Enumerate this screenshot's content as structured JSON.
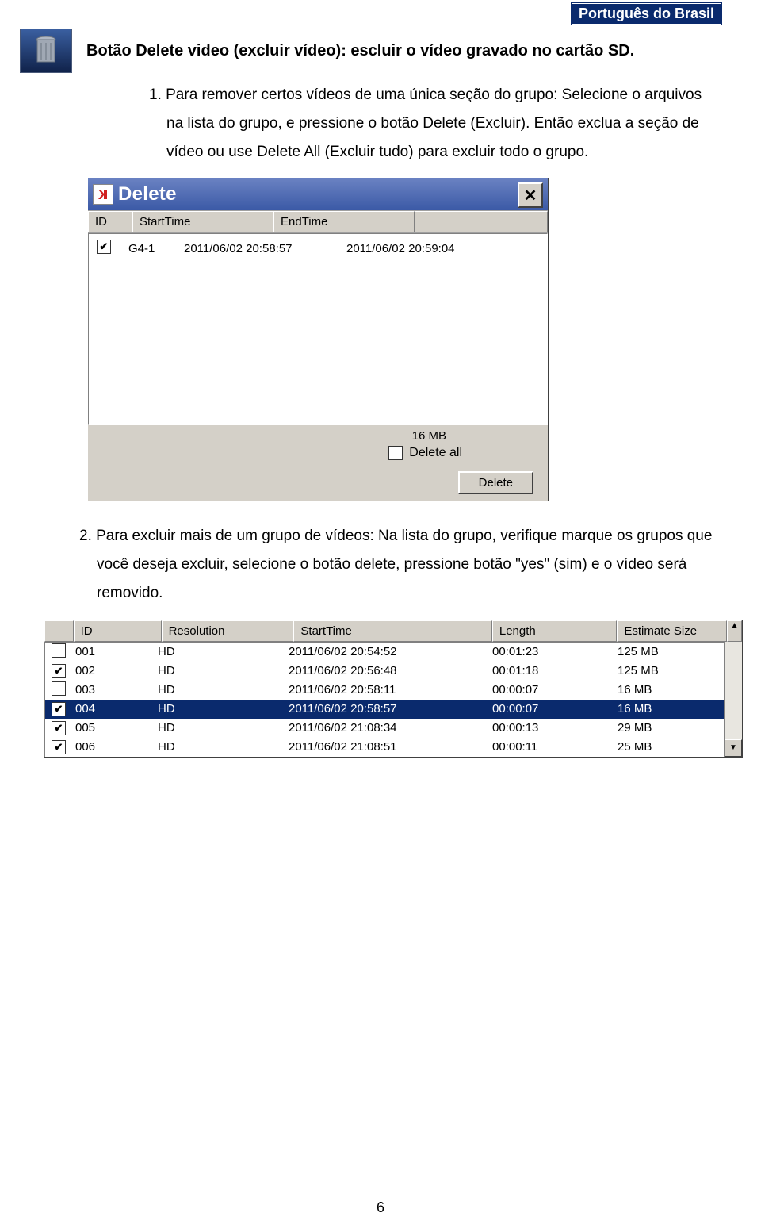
{
  "lang_badge": "Português do Brasil",
  "heading": "Botão Delete video (excluir vídeo): escluir o vídeo gravado no cartão SD.",
  "para1": "1. Para remover certos vídeos de uma única seção do grupo: Selecione o arquivos na lista do grupo, e pressione o botão Delete (Excluir). Então exclua a seção de vídeo ou use Delete All (Excluir tudo) para excluir todo o grupo.",
  "dialog": {
    "title": "Delete",
    "close": "✕",
    "headers": {
      "id": "ID",
      "start": "StartTime",
      "end": "EndTime"
    },
    "rows": [
      {
        "checked": true,
        "id": "G4-1",
        "start": "2011/06/02 20:58:57",
        "end": "2011/06/02 20:59:04"
      }
    ],
    "size": "16 MB",
    "delete_all_label": "Delete all",
    "delete_btn": "Delete"
  },
  "para2": "2. Para excluir mais de um grupo de vídeos: Na lista do grupo, verifique marque os grupos que você deseja excluir, selecione o botão delete, pressione botão \"yes\" (sim) e o vídeo será removido.",
  "wide": {
    "headers": {
      "id": "ID",
      "res": "Resolution",
      "st": "StartTime",
      "len": "Length",
      "es": "Estimate Size"
    },
    "rows": [
      {
        "checked": false,
        "id": "001",
        "res": "HD",
        "st": "2011/06/02 20:54:52",
        "len": "00:01:23",
        "es": "125 MB",
        "selected": false
      },
      {
        "checked": true,
        "id": "002",
        "res": "HD",
        "st": "2011/06/02 20:56:48",
        "len": "00:01:18",
        "es": "125 MB",
        "selected": false
      },
      {
        "checked": false,
        "id": "003",
        "res": "HD",
        "st": "2011/06/02 20:58:11",
        "len": "00:00:07",
        "es": "16 MB",
        "selected": false
      },
      {
        "checked": true,
        "id": "004",
        "res": "HD",
        "st": "2011/06/02 20:58:57",
        "len": "00:00:07",
        "es": "16 MB",
        "selected": true
      },
      {
        "checked": true,
        "id": "005",
        "res": "HD",
        "st": "2011/06/02 21:08:34",
        "len": "00:00:13",
        "es": "29 MB",
        "selected": false
      },
      {
        "checked": true,
        "id": "006",
        "res": "HD",
        "st": "2011/06/02 21:08:51",
        "len": "00:00:11",
        "es": "25 MB",
        "selected": false
      }
    ]
  },
  "page_number": "6"
}
